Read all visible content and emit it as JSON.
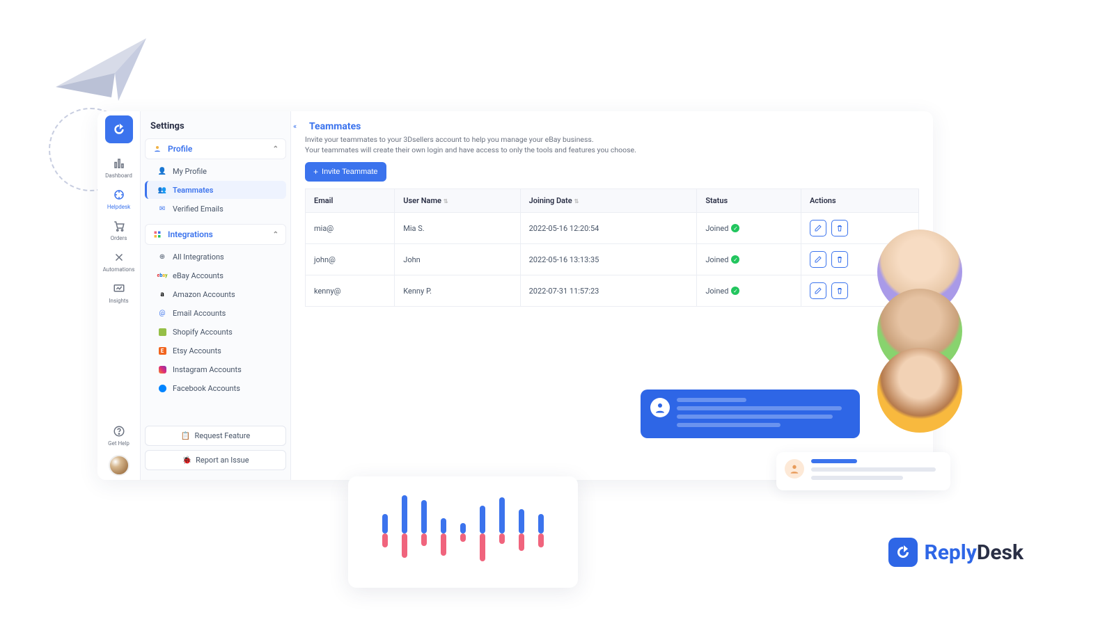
{
  "nav": {
    "items": [
      {
        "name": "dashboard",
        "label": "Dashboard"
      },
      {
        "name": "helpdesk",
        "label": "Helpdesk"
      },
      {
        "name": "orders",
        "label": "Orders"
      },
      {
        "name": "automations",
        "label": "Automations"
      },
      {
        "name": "insights",
        "label": "Insights"
      }
    ],
    "get_help_label": "Get Help"
  },
  "settings_sidebar": {
    "title": "Settings",
    "sections": {
      "profile": {
        "label": "Profile",
        "items": [
          {
            "name": "my-profile",
            "label": "My Profile"
          },
          {
            "name": "teammates",
            "label": "Teammates",
            "active": true
          },
          {
            "name": "verified-emails",
            "label": "Verified Emails"
          }
        ]
      },
      "integrations": {
        "label": "Integrations",
        "items": [
          {
            "name": "all-integrations",
            "label": "All Integrations"
          },
          {
            "name": "ebay-accounts",
            "label": "eBay Accounts"
          },
          {
            "name": "amazon-accounts",
            "label": "Amazon Accounts"
          },
          {
            "name": "email-accounts",
            "label": "Email Accounts"
          },
          {
            "name": "shopify-accounts",
            "label": "Shopify Accounts"
          },
          {
            "name": "etsy-accounts",
            "label": "Etsy Accounts"
          },
          {
            "name": "instagram-accounts",
            "label": "Instagram Accounts"
          },
          {
            "name": "facebook-accounts",
            "label": "Facebook Accounts"
          }
        ]
      }
    },
    "request_feature": "Request Feature",
    "report_issue": "Report an Issue"
  },
  "page": {
    "title": "Teammates",
    "desc_line1": "Invite your teammates to your 3Dsellers account to help you manage your eBay business.",
    "desc_line2": "Your teammates will create their own login and have access to only the tools and features you choose.",
    "invite_btn": "Invite Teammate"
  },
  "table": {
    "headers": {
      "email": "Email",
      "user_name": "User Name",
      "joining_date": "Joining Date",
      "status": "Status",
      "actions": "Actions"
    },
    "rows": [
      {
        "email": "mia@",
        "user_name": "Mia S.",
        "joining_date": "2022-05-16 12:20:54",
        "status": "Joined"
      },
      {
        "email": "john@",
        "user_name": "John",
        "joining_date": "2022-05-16 13:13:35",
        "status": "Joined"
      },
      {
        "email": "kenny@",
        "user_name": "Kenny P.",
        "joining_date": "2022-07-31 11:57:23",
        "status": "Joined"
      }
    ]
  },
  "chart": {
    "bars": [
      {
        "up": 28,
        "down": 20
      },
      {
        "up": 55,
        "down": 35
      },
      {
        "up": 48,
        "down": 18
      },
      {
        "up": 22,
        "down": 32
      },
      {
        "up": 15,
        "down": 12
      },
      {
        "up": 40,
        "down": 40
      },
      {
        "up": 52,
        "down": 15
      },
      {
        "up": 35,
        "down": 25
      },
      {
        "up": 28,
        "down": 20
      }
    ]
  },
  "brand": {
    "name": "ReplyDesk",
    "name_prefix": "Reply",
    "name_suffix": "Desk"
  }
}
